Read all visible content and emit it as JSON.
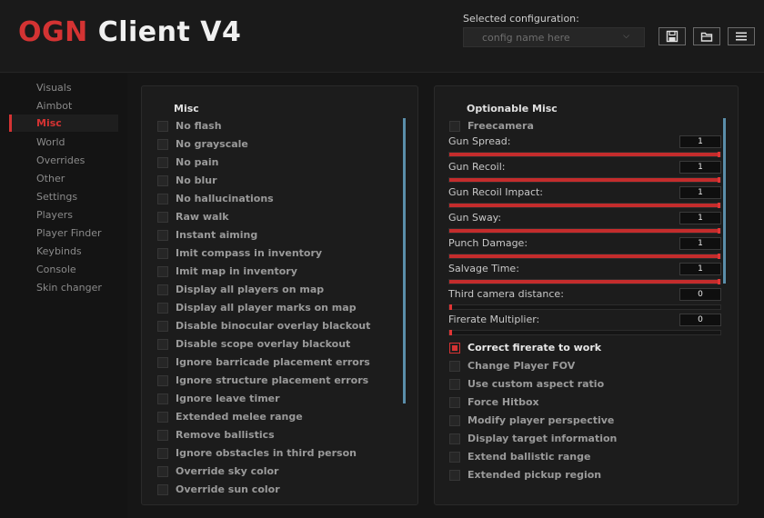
{
  "header": {
    "logo_brand": "OGN",
    "logo_rest": "Client V4",
    "config_label": "Selected configuration:",
    "config_placeholder": "config name here",
    "buttons": [
      "save-icon",
      "folder-icon",
      "menu-icon"
    ]
  },
  "colors": {
    "accent": "#d43333",
    "scrollbar": "#5a8eaa"
  },
  "sidebar": {
    "active": "Misc",
    "items": [
      "Visuals",
      "Aimbot",
      "Misc",
      "World",
      "Overrides",
      "Other",
      "Settings",
      "Players",
      "Player Finder",
      "Keybinds",
      "Console",
      "Skin changer"
    ]
  },
  "left_panel": {
    "title": "Misc",
    "options": [
      {
        "label": "No flash",
        "checked": false
      },
      {
        "label": "No grayscale",
        "checked": false
      },
      {
        "label": "No pain",
        "checked": false
      },
      {
        "label": "No blur",
        "checked": false
      },
      {
        "label": "No hallucinations",
        "checked": false
      },
      {
        "label": "Raw walk",
        "checked": false
      },
      {
        "label": "Instant aiming",
        "checked": false
      },
      {
        "label": "Imit compass in inventory",
        "checked": false
      },
      {
        "label": "Imit map in inventory",
        "checked": false
      },
      {
        "label": "Display all players on map",
        "checked": false
      },
      {
        "label": "Display all player marks on map",
        "checked": false
      },
      {
        "label": "Disable binocular overlay blackout",
        "checked": false
      },
      {
        "label": "Disable scope overlay blackout",
        "checked": false
      },
      {
        "label": "Ignore barricade placement errors",
        "checked": false
      },
      {
        "label": "Ignore structure placement errors",
        "checked": false
      },
      {
        "label": "Ignore leave timer",
        "checked": false
      },
      {
        "label": "Extended melee range",
        "checked": false
      },
      {
        "label": "Remove ballistics",
        "checked": false
      },
      {
        "label": "Ignore obstacles in third person",
        "checked": false
      },
      {
        "label": "Override sky color",
        "checked": false
      },
      {
        "label": "Override sun color",
        "checked": false
      }
    ]
  },
  "right_panel": {
    "title": "Optionable Misc",
    "freecamera": {
      "label": "Freecamera",
      "checked": false
    },
    "sliders": [
      {
        "label": "Gun Spread:",
        "value": "1",
        "fill": 1.0
      },
      {
        "label": "Gun Recoil:",
        "value": "1",
        "fill": 1.0
      },
      {
        "label": "Gun Recoil Impact:",
        "value": "1",
        "fill": 1.0
      },
      {
        "label": "Gun Sway:",
        "value": "1",
        "fill": 1.0
      },
      {
        "label": "Punch Damage:",
        "value": "1",
        "fill": 1.0
      },
      {
        "label": "Salvage Time:",
        "value": "1",
        "fill": 1.0
      },
      {
        "label": "Third camera distance:",
        "value": "0",
        "fill": 0.0
      },
      {
        "label": "Firerate Multiplier:",
        "value": "0",
        "fill": 0.0
      }
    ],
    "options": [
      {
        "label": "Correct firerate to work",
        "checked": true
      },
      {
        "label": "Change Player FOV",
        "checked": false
      },
      {
        "label": "Use custom aspect ratio",
        "checked": false
      },
      {
        "label": "Force Hitbox",
        "checked": false
      },
      {
        "label": "Modify player perspective",
        "checked": false
      },
      {
        "label": "Display target information",
        "checked": false
      },
      {
        "label": "Extend ballistic range",
        "checked": false
      },
      {
        "label": "Extended pickup region",
        "checked": false
      }
    ]
  }
}
